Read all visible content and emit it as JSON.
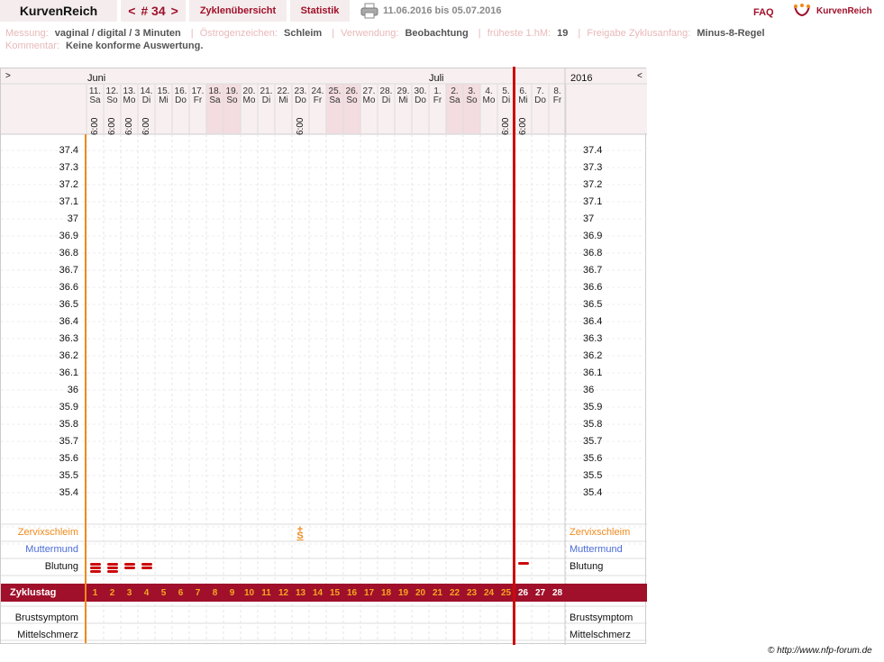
{
  "topbar": {
    "brand": "KurvenReich",
    "nav_prev": "<",
    "cycle_label": "# 34",
    "nav_next": ">",
    "cycles_overview": "Zyklenübersicht",
    "statistics": "Statistik",
    "date_range": "11.06.2016 bis 05.07.2016",
    "faq": "FAQ",
    "logo_text": "KurvenReich",
    "print_icon": "printer-icon"
  },
  "info": {
    "messung_label": "Messung:",
    "messung_value": "vaginal / digital / 3 Minuten",
    "oestrogen_label": "Östrogenzeichen:",
    "oestrogen_value": "Schleim",
    "verwendung_label": "Verwendung:",
    "verwendung_value": "Beobachtung",
    "fhm_label": "früheste 1.hM:",
    "fhm_value": "19",
    "freigabe_label": "Freigabe Zyklusanfang:",
    "freigabe_value": "Minus-8-Regel",
    "kommentar_label": "Kommentar:",
    "kommentar_value": "Keine konforme Auswertung."
  },
  "chart": {
    "arrow_left": ">",
    "arrow_right": "<",
    "year": "2016",
    "months": [
      "Juni",
      "Juli"
    ],
    "days": [
      {
        "d": "11.",
        "w": "Sa",
        "time": "6:00",
        "we": false
      },
      {
        "d": "12.",
        "w": "So",
        "time": "6:00",
        "we": false
      },
      {
        "d": "13.",
        "w": "Mo",
        "time": "6:00",
        "we": false
      },
      {
        "d": "14.",
        "w": "Di",
        "time": "6:00",
        "we": false
      },
      {
        "d": "15.",
        "w": "Mi",
        "time": "",
        "we": false
      },
      {
        "d": "16.",
        "w": "Do",
        "time": "",
        "we": false
      },
      {
        "d": "17.",
        "w": "Fr",
        "time": "",
        "we": false
      },
      {
        "d": "18.",
        "w": "Sa",
        "time": "",
        "we": true
      },
      {
        "d": "19.",
        "w": "So",
        "time": "",
        "we": true
      },
      {
        "d": "20.",
        "w": "Mo",
        "time": "",
        "we": false
      },
      {
        "d": "21.",
        "w": "Di",
        "time": "",
        "we": false
      },
      {
        "d": "22.",
        "w": "Mi",
        "time": "",
        "we": false
      },
      {
        "d": "23.",
        "w": "Do",
        "time": "6:00",
        "we": false
      },
      {
        "d": "24.",
        "w": "Fr",
        "time": "",
        "we": false
      },
      {
        "d": "25.",
        "w": "Sa",
        "time": "",
        "we": true
      },
      {
        "d": "26.",
        "w": "So",
        "time": "",
        "we": true
      },
      {
        "d": "27.",
        "w": "Mo",
        "time": "",
        "we": false
      },
      {
        "d": "28.",
        "w": "Di",
        "time": "",
        "we": false
      },
      {
        "d": "29.",
        "w": "Mi",
        "time": "",
        "we": false
      },
      {
        "d": "30.",
        "w": "Do",
        "time": "",
        "we": false
      },
      {
        "d": "1.",
        "w": "Fr",
        "time": "",
        "we": false
      },
      {
        "d": "2.",
        "w": "Sa",
        "time": "",
        "we": true
      },
      {
        "d": "3.",
        "w": "So",
        "time": "",
        "we": true
      },
      {
        "d": "4.",
        "w": "Mo",
        "time": "",
        "we": false
      },
      {
        "d": "5.",
        "w": "Di",
        "time": "6:00",
        "we": false
      },
      {
        "d": "6.",
        "w": "Mi",
        "time": "6:00",
        "we": false
      },
      {
        "d": "7.",
        "w": "Do",
        "time": "",
        "we": false
      },
      {
        "d": "8.",
        "w": "Fr",
        "time": "",
        "we": false
      }
    ],
    "temperatures": [
      "37.4",
      "37.3",
      "37.2",
      "37.1",
      "37",
      "36.9",
      "36.8",
      "36.7",
      "36.6",
      "36.5",
      "36.4",
      "36.3",
      "36.2",
      "36.1",
      "36",
      "35.9",
      "35.8",
      "35.7",
      "35.6",
      "35.5",
      "35.4"
    ],
    "rows": {
      "zervixschleim": "Zervixschleim",
      "muttermund": "Muttermund",
      "blutung": "Blutung",
      "zyklustag": "Zyklustag",
      "brustsymptom": "Brustsymptom",
      "mittelschmerz": "Mittelschmerz"
    },
    "cycle_days": [
      "1",
      "2",
      "3",
      "4",
      "5",
      "6",
      "7",
      "8",
      "9",
      "10",
      "11",
      "12",
      "13",
      "14",
      "15",
      "16",
      "17",
      "18",
      "19",
      "20",
      "21",
      "22",
      "23",
      "24",
      "25",
      "26",
      "27",
      "28"
    ],
    "cycle_end_index": 25,
    "bleeding": [
      {
        "day": 0,
        "level": 3
      },
      {
        "day": 1,
        "level": 3
      },
      {
        "day": 2,
        "level": 2
      },
      {
        "day": 3,
        "level": 2
      },
      {
        "day": 25,
        "level": 1
      }
    ],
    "mucus_mark": {
      "day": 12,
      "symbol": "S",
      "sign": "+"
    },
    "colors": {
      "accent": "#a0102a",
      "cycle_start": "#f08a1c",
      "cycle_end": "#cc0a0a",
      "weekend": "#f3dde0",
      "mucus": "#f08a1c",
      "muttermund": "#4a6bd6"
    }
  },
  "footer": {
    "copyright": "© http://www.nfp-forum.de"
  }
}
